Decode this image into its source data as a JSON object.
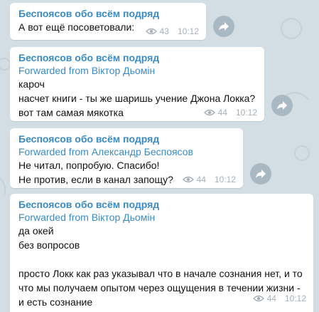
{
  "colors": {
    "background": "#d3dde4",
    "bubble": "#ffffff",
    "sender": "#3a8bc4",
    "meta": "#a7b0b8",
    "share_button": "#a9b9c4"
  },
  "messages": [
    {
      "sender": "Беспоясов обо всём подряд",
      "forwarded": "",
      "lines": [
        "А вот ещё посоветовали:"
      ],
      "views": "43",
      "time": "10:12"
    },
    {
      "sender": "Беспоясов обо всём подряд",
      "forwarded": "Forwarded from Віктор Дьомін",
      "lines": [
        "кароч",
        "насчет книги - ты же шаришь учение Джона Локка?",
        "вот там самая мякотка"
      ],
      "views": "44",
      "time": "10:12"
    },
    {
      "sender": "Беспоясов обо всём подряд",
      "forwarded": "Forwarded from Александр Беспоясов",
      "lines": [
        "Не читал, попробую. Спасибо!",
        "Не против, если в канал запощу?"
      ],
      "views": "44",
      "time": "10:12"
    },
    {
      "sender": "Беспоясов обо всём подряд",
      "forwarded": "Forwarded from Віктор Дьомін",
      "lines": [
        "да окей",
        "без вопросов",
        "",
        "просто Локк как раз указывал что в начале сознания нет, и то",
        "что мы получаем опытом через ощущения в течении жизни -",
        "и есть сознание"
      ],
      "views": "44",
      "time": "10:12"
    }
  ],
  "icons": {
    "views": "eye-icon",
    "share": "share-arrow-icon"
  }
}
